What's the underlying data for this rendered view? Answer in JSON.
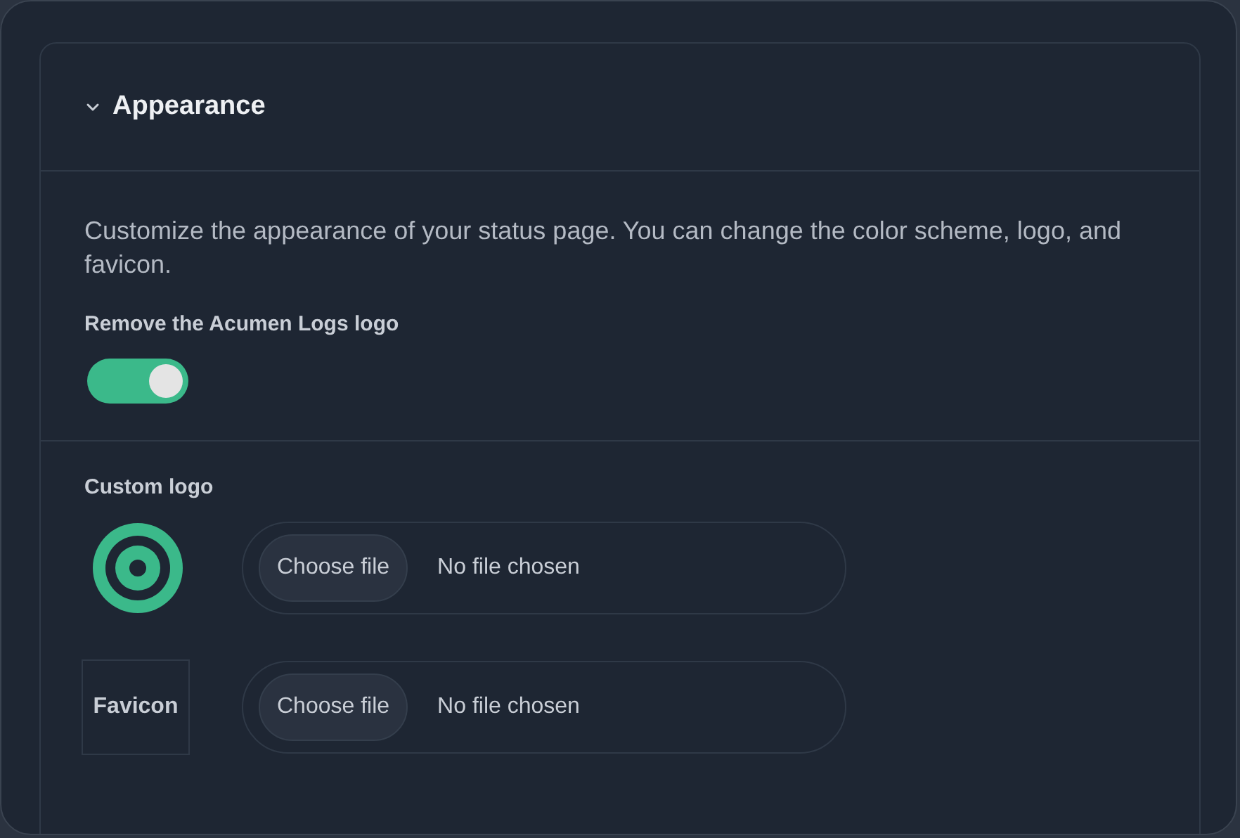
{
  "section": {
    "title": "Appearance",
    "expanded": true
  },
  "description": "Customize the appearance of your status page. You can change the color scheme, logo, and favicon.",
  "toggle": {
    "label": "Remove the Acumen Logs logo",
    "on": true
  },
  "custom_logo": {
    "label": "Custom logo"
  },
  "uploads": [
    {
      "kind": "logo",
      "button": "Choose file",
      "status": "No file chosen"
    },
    {
      "kind": "favicon",
      "alt": "Favicon",
      "button": "Choose file",
      "status": "No file chosen"
    }
  ]
}
